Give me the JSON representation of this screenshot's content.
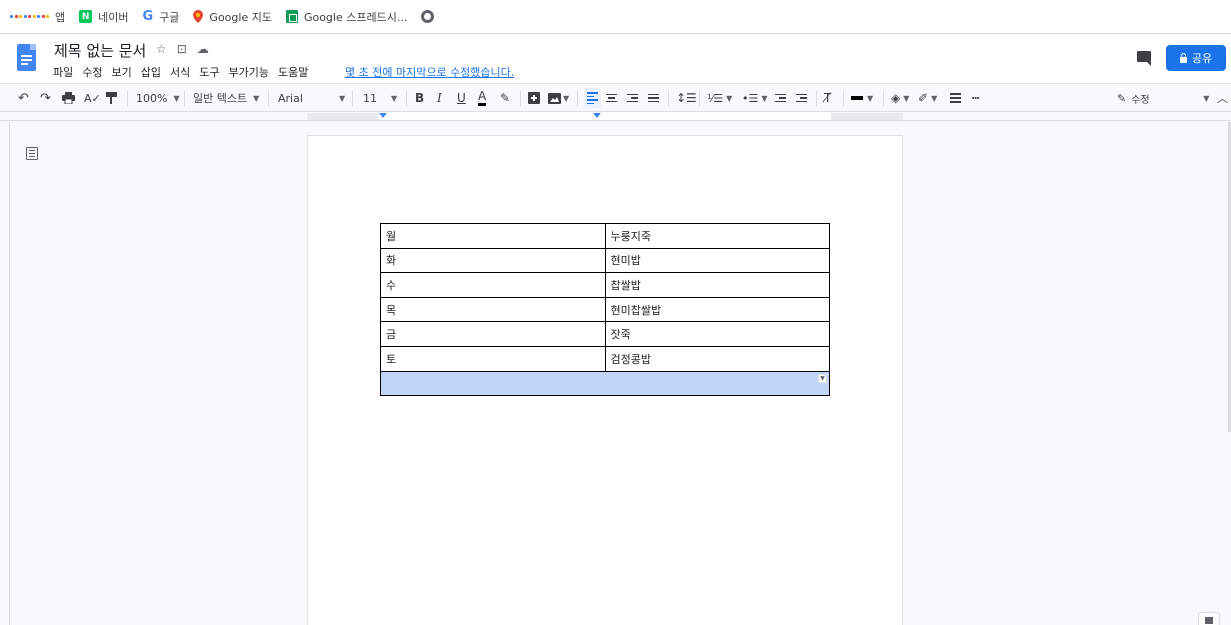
{
  "bookmarks": {
    "items": [
      {
        "label": "앱",
        "icon": "apps-grid-icon"
      },
      {
        "label": "네이버",
        "icon": "naver-icon"
      },
      {
        "label": "구글",
        "icon": "google-icon"
      },
      {
        "label": "Google 지도",
        "icon": "maps-pin-icon"
      },
      {
        "label": "Google 스프레드시...",
        "icon": "sheets-icon"
      },
      {
        "label": "",
        "icon": "globe-icon"
      }
    ]
  },
  "doc": {
    "title": "제목 없는 문서",
    "last_edit": "몇 초 전에 마지막으로 수정했습니다.",
    "share_label": "공유"
  },
  "menus": [
    "파일",
    "수정",
    "보기",
    "삽입",
    "서식",
    "도구",
    "부가기능",
    "도움말"
  ],
  "toolbar": {
    "zoom": "100%",
    "style": "일반 텍스트",
    "font": "Arial",
    "font_size": "11",
    "bold": "B",
    "italic": "I",
    "underline": "U",
    "text_color": "A",
    "mode": "수정",
    "accent": "#1a73e8"
  },
  "table": {
    "rows": [
      [
        "월",
        "누룽지죽"
      ],
      [
        "화",
        "현미밥"
      ],
      [
        "수",
        "찹쌀밥"
      ],
      [
        "목",
        "현미찹쌀밥"
      ],
      [
        "금",
        "잣죽"
      ],
      [
        "토",
        "검정콩밥"
      ]
    ],
    "selected_row_color": "#c3d5f7"
  }
}
